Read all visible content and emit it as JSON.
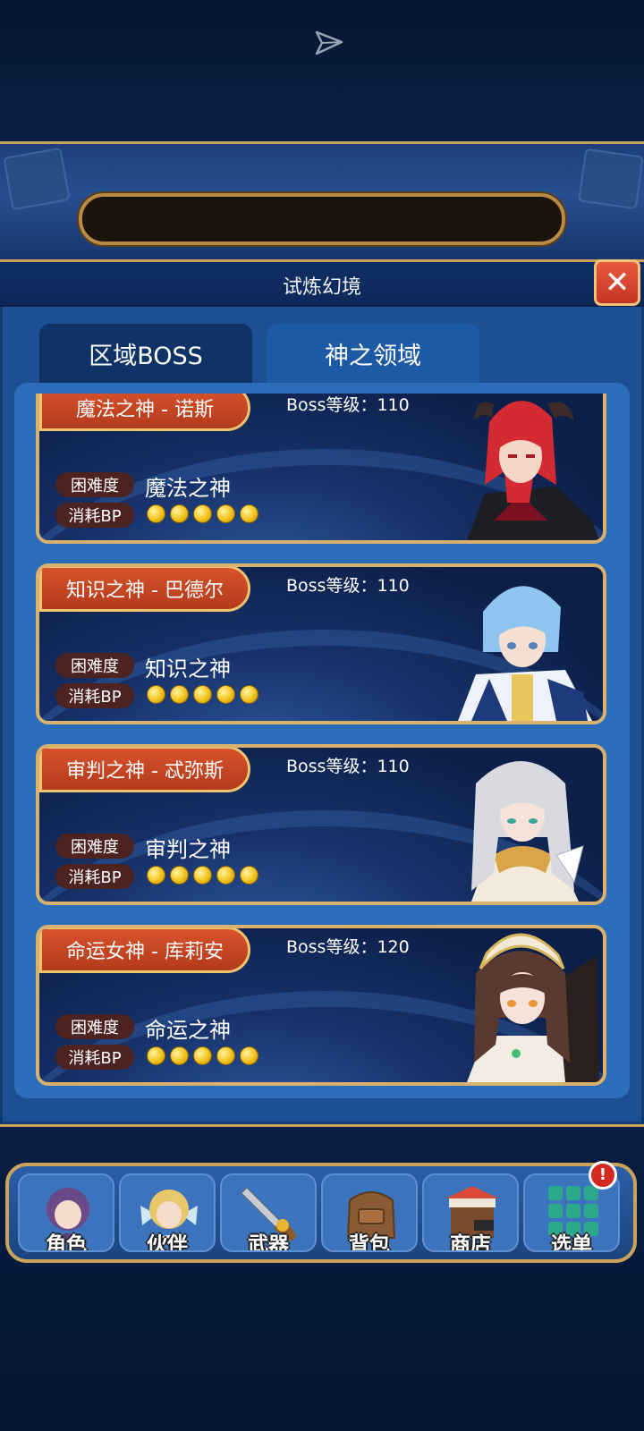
{
  "panel": {
    "title": "试炼幻境",
    "close_label": "✕"
  },
  "tabs": [
    {
      "label": "区域BOSS",
      "active": false
    },
    {
      "label": "神之领域",
      "active": true
    }
  ],
  "bosses": [
    {
      "name": "魔法之神 - 诺斯",
      "level": "Boss等级：110",
      "difficulty_label": "困难度",
      "difficulty": "魔法之神",
      "bp_label": "消耗BP",
      "bp_cost": 5,
      "portrait": "red-haired-horned-god"
    },
    {
      "name": "知识之神 - 巴德尔",
      "level": "Boss等级：110",
      "difficulty_label": "困难度",
      "difficulty": "知识之神",
      "bp_label": "消耗BP",
      "bp_cost": 5,
      "portrait": "blue-haired-god"
    },
    {
      "name": "审判之神 - 忒弥斯",
      "level": "Boss等级：110",
      "difficulty_label": "困难度",
      "difficulty": "审判之神",
      "bp_label": "消耗BP",
      "bp_cost": 5,
      "portrait": "silver-haired-goddess"
    },
    {
      "name": "命运女神 - 库莉安",
      "level": "Boss等级：120",
      "difficulty_label": "困难度",
      "difficulty": "命运之神",
      "bp_label": "消耗BP",
      "bp_cost": 5,
      "portrait": "veiled-dark-haired-goddess"
    }
  ],
  "nav": [
    {
      "label": "角色",
      "icon": "character-icon"
    },
    {
      "label": "伙伴",
      "icon": "partner-icon"
    },
    {
      "label": "武器",
      "icon": "weapon-icon"
    },
    {
      "label": "背包",
      "icon": "backpack-icon"
    },
    {
      "label": "商店",
      "icon": "shop-icon"
    },
    {
      "label": "选单",
      "icon": "menu-grid-icon"
    }
  ],
  "menu_alert": "!",
  "colors": {
    "accent_gold": "#c9a35a",
    "name_plate": "#c9462a",
    "panel_blue": "#1c4f93"
  }
}
